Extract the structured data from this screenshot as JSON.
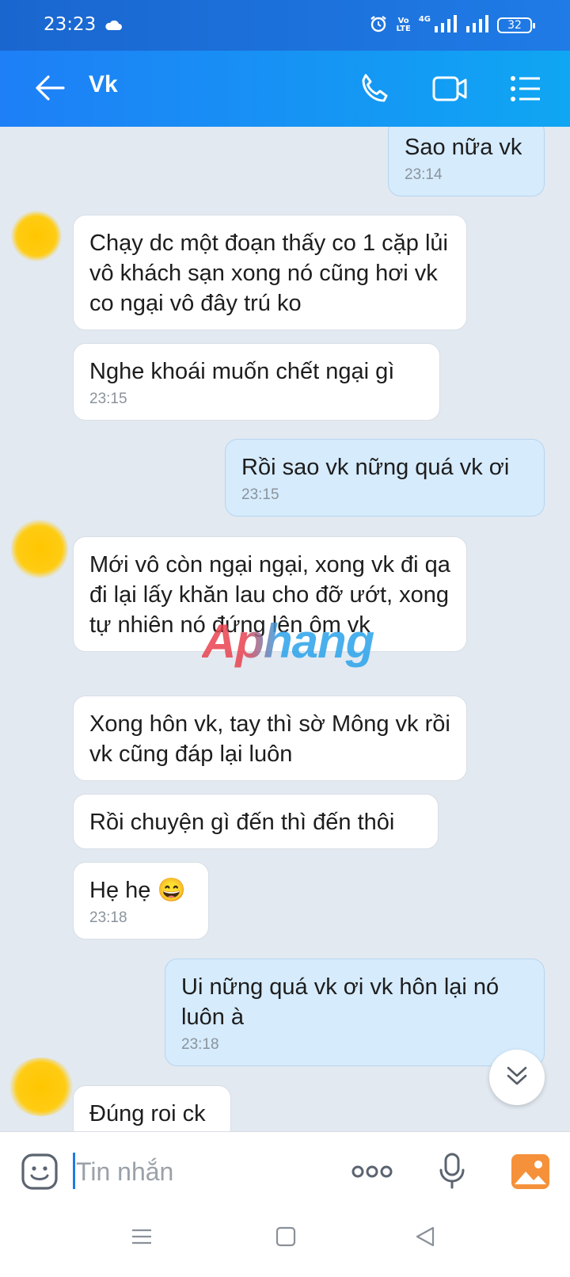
{
  "status_bar": {
    "time": "23:23",
    "volte_top": "Vo",
    "volte_bottom": "LTE",
    "network": "4G",
    "battery": "32"
  },
  "header": {
    "title": "Vk"
  },
  "messages": [
    {
      "side": "out",
      "text": "Sao nữa vk",
      "time": "23:14"
    },
    {
      "side": "in",
      "text": "Chạy dc một đoạn thấy co 1 cặp lủi vô khách sạn xong nó cũng hơi vk co ngại vô đây trú ko",
      "time": ""
    },
    {
      "side": "in",
      "text": "Nghe khoái muốn chết ngại gì",
      "time": "23:15"
    },
    {
      "side": "out",
      "text": "Rồi sao vk nững quá vk ơi",
      "time": "23:15"
    },
    {
      "side": "in",
      "text": "Mới vô còn ngại ngại, xong vk đi qa đi lại lấy khăn lau cho đỡ ướt, xong tự nhiên nó đứng lên ôm vk",
      "time": ""
    },
    {
      "side": "in",
      "text": "Xong hôn vk, tay thì sờ Mông vk rồi vk cũng đáp lại luôn",
      "time": ""
    },
    {
      "side": "in",
      "text": "Rồi chuyện gì đến thì đến thôi",
      "time": ""
    },
    {
      "side": "in",
      "text": "Hẹ hẹ 😄",
      "time": "23:18"
    },
    {
      "side": "out",
      "text": "Ui nững quá vk ơi vk hôn lại nó luôn à",
      "time": "23:18"
    },
    {
      "side": "in",
      "text": "Đúng roi ck",
      "time": ""
    }
  ],
  "watermark": "Aphang",
  "input": {
    "placeholder": "Tin nhắn",
    "value": ""
  },
  "icons": {
    "back": "arrow-left-icon",
    "call": "phone-icon",
    "video": "video-camera-icon",
    "menu": "list-menu-icon",
    "emoji": "sticker-icon",
    "more": "more-dots-icon",
    "mic": "microphone-icon",
    "image": "image-gallery-icon",
    "scroll": "chevron-double-down-icon"
  },
  "colors": {
    "header_start": "#1e7ff6",
    "header_end": "#0fa6f3",
    "chat_bg": "#e2e9f1",
    "incoming_bubble": "#ffffff",
    "outgoing_bubble": "#d6ebfc",
    "accent": "#1f7be6",
    "image_icon": "#f5913a"
  }
}
